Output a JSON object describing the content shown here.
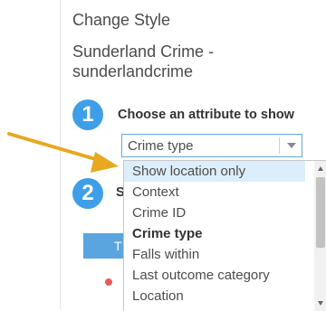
{
  "panel": {
    "title": "Change Style",
    "layer_name": "Sunderland Crime - sunderlandcrime"
  },
  "steps": [
    {
      "number": "1",
      "label": "Choose an attribute to show"
    },
    {
      "number": "2",
      "label": "S"
    }
  ],
  "attribute_select": {
    "value": "Crime type"
  },
  "dropdown": {
    "items": [
      {
        "label": "Show location only",
        "state": "highlighted"
      },
      {
        "label": "Context",
        "state": "normal"
      },
      {
        "label": "Crime ID",
        "state": "normal"
      },
      {
        "label": "Crime type",
        "state": "selected"
      },
      {
        "label": "Falls within",
        "state": "normal"
      },
      {
        "label": "Last outcome category",
        "state": "normal"
      },
      {
        "label": "Location",
        "state": "normal"
      }
    ]
  },
  "background_tab_letter": "T",
  "colors": {
    "accent": "#3e9fe8",
    "annotation_arrow": "#e8a820",
    "highlight_row": "#dceefb",
    "select_border": "#62a8d6"
  },
  "icons": {
    "annotation_arrow": "arrow-right-icon",
    "select_chevron": "chevron-down-icon",
    "scroll_up": "triangle-up-icon",
    "scroll_down": "triangle-down-icon"
  }
}
